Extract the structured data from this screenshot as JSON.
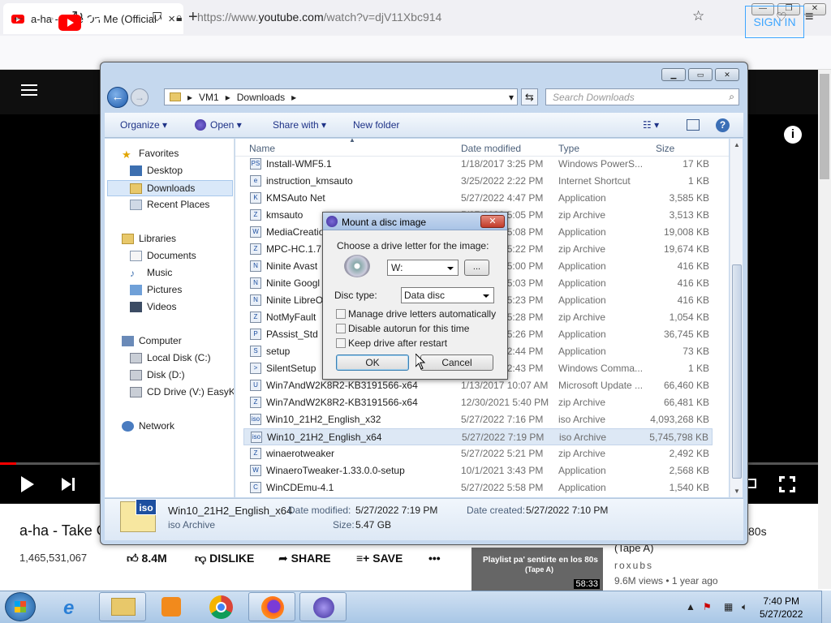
{
  "browser": {
    "tab_title": "a-ha - Take On Me (Official Vid",
    "tab_close": "×",
    "new_tab": "+",
    "url_prefix": "https://www.",
    "url_domain": "youtube.com",
    "url_suffix": "/watch?v=djV11Xbc914",
    "window_min": "—",
    "window_restore": "❐",
    "window_close": "✕"
  },
  "youtube": {
    "logo_text": "Yo",
    "sign_in": "SIGN IN",
    "info": "i",
    "video_title": "a-ha - Take O",
    "views": "1,465,531,067",
    "like": "8.4M",
    "dislike": "DISLIKE",
    "share": "SHARE",
    "save": "SAVE",
    "more": "•••",
    "side_title": "(Tape A)",
    "side_suffix": "80s",
    "side_channel": "roxubs",
    "side_meta": "9.6M views • 1 year ago",
    "thumb_text": "Playlist pa' sentirte en los 80s",
    "thumb_sub": "(Tape A)",
    "thumb_duration": "58:33",
    "progress": 0.02
  },
  "explorer": {
    "breadcrumb": [
      "VM1",
      "Downloads"
    ],
    "search_placeholder": "Search Downloads",
    "toolbar": {
      "organize": "Organize ▾",
      "open": "Open ▾",
      "share_with": "Share with ▾",
      "new_folder": "New folder"
    },
    "nav": {
      "favorites": "Favorites",
      "desktop": "Desktop",
      "downloads": "Downloads",
      "recent": "Recent Places",
      "libraries": "Libraries",
      "documents": "Documents",
      "music": "Music",
      "pictures": "Pictures",
      "videos": "Videos",
      "computer": "Computer",
      "local_disk": "Local Disk (C:)",
      "disk_d": "Disk (D:)",
      "cd_drive": "CD Drive (V:) EasyKM",
      "network": "Network"
    },
    "columns": {
      "name": "Name",
      "date": "Date modified",
      "type": "Type",
      "size": "Size"
    },
    "files": [
      {
        "name": "Install-WMF5.1",
        "date": "1/18/2017 3:25 PM",
        "type": "Windows PowerS...",
        "size": "17 KB",
        "icon": "PS"
      },
      {
        "name": "instruction_kmsauto",
        "date": "3/25/2022 2:22 PM",
        "type": "Internet Shortcut",
        "size": "1 KB",
        "icon": "e"
      },
      {
        "name": "KMSAuto Net",
        "date": "5/27/2022 4:47 PM",
        "type": "Application",
        "size": "3,585 KB",
        "icon": "K"
      },
      {
        "name": "kmsauto",
        "date": "5/27/2022 5:05 PM",
        "type": "zip Archive",
        "size": "3,513 KB",
        "icon": "Z"
      },
      {
        "name": "MediaCreation",
        "date": "5/27/2022 5:08 PM",
        "type": "Application",
        "size": "19,008 KB",
        "icon": "W"
      },
      {
        "name": "MPC-HC.1.7.",
        "date": "5/27/2022 5:22 PM",
        "type": "zip Archive",
        "size": "19,674 KB",
        "icon": "Z"
      },
      {
        "name": "Ninite Avast",
        "date": "5/27/2022 5:00 PM",
        "type": "Application",
        "size": "416 KB",
        "icon": "N"
      },
      {
        "name": "Ninite Googl",
        "date": "5/27/2022 5:03 PM",
        "type": "Application",
        "size": "416 KB",
        "icon": "N"
      },
      {
        "name": "Ninite LibreO",
        "date": "5/27/2022 5:23 PM",
        "type": "Application",
        "size": "416 KB",
        "icon": "N"
      },
      {
        "name": "NotMyFault",
        "date": "5/27/2022 5:28 PM",
        "type": "zip Archive",
        "size": "1,054 KB",
        "icon": "Z"
      },
      {
        "name": "PAssist_Std",
        "date": "5/27/2022 5:26 PM",
        "type": "Application",
        "size": "36,745 KB",
        "icon": "P"
      },
      {
        "name": "setup",
        "date": "5/27/2022 2:44 PM",
        "type": "Application",
        "size": "73 KB",
        "icon": "S"
      },
      {
        "name": "SilentSetup",
        "date": "5/27/2022 2:43 PM",
        "type": "Windows Comma...",
        "size": "1 KB",
        "icon": ">"
      },
      {
        "name": "Win7AndW2K8R2-KB3191566-x64",
        "date": "1/13/2017 10:07 AM",
        "type": "Microsoft Update ...",
        "size": "66,460 KB",
        "icon": "U"
      },
      {
        "name": "Win7AndW2K8R2-KB3191566-x64",
        "date": "12/30/2021 5:40 PM",
        "type": "zip Archive",
        "size": "66,481 KB",
        "icon": "Z"
      },
      {
        "name": "Win10_21H2_English_x32",
        "date": "5/27/2022 7:16 PM",
        "type": "iso Archive",
        "size": "4,093,268 KB",
        "icon": "iso"
      },
      {
        "name": "Win10_21H2_English_x64",
        "date": "5/27/2022 7:19 PM",
        "type": "iso Archive",
        "size": "5,745,798 KB",
        "icon": "iso",
        "selected": true
      },
      {
        "name": "winaerotweaker",
        "date": "5/27/2022 5:21 PM",
        "type": "zip Archive",
        "size": "2,492 KB",
        "icon": "Z"
      },
      {
        "name": "WinaeroTweaker-1.33.0.0-setup",
        "date": "10/1/2021 3:43 PM",
        "type": "Application",
        "size": "2,568 KB",
        "icon": "W"
      },
      {
        "name": "WinCDEmu-4.1",
        "date": "5/27/2022 5:58 PM",
        "type": "Application",
        "size": "1,540 KB",
        "icon": "C"
      }
    ],
    "details": {
      "name": "Win10_21H2_English_x64",
      "type": "iso Archive",
      "modified_label": "Date modified:",
      "modified": "5/27/2022 7:19 PM",
      "created_label": "Date created:",
      "created": "5/27/2022 7:10 PM",
      "size_label": "Size:",
      "size": "5.47 GB",
      "icon_text": "iso"
    }
  },
  "dialog": {
    "title": "Mount a disc image",
    "close": "✕",
    "prompt": "Choose a drive letter for the image:",
    "drive": "W:",
    "browse": "...",
    "disc_type_label": "Disc type:",
    "disc_type": "Data disc",
    "cb_manage": "Manage drive letters automatically",
    "cb_autorun": "Disable autorun for this time",
    "cb_keep": "Keep drive after restart",
    "ok": "OK",
    "cancel": "Cancel"
  },
  "taskbar": {
    "time": "7:40 PM",
    "date": "5/27/2022"
  }
}
